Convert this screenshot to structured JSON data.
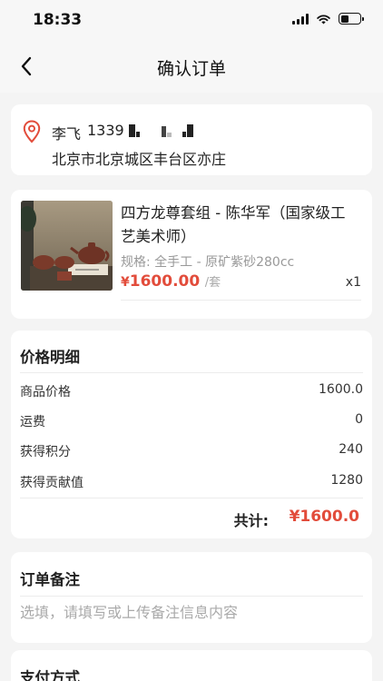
{
  "status_bar": {
    "time": "18:33"
  },
  "nav": {
    "title": "确认订单",
    "back_icon": "chevron-left-icon"
  },
  "address": {
    "name": "李飞",
    "phone_visible": "1339",
    "detail": "北京市北京城区丰台区亦庄"
  },
  "product": {
    "title": "四方龙尊套组 - 陈华军（国家级工艺美术师）",
    "spec": "规格: 全手工 - 原矿紫砂280cc",
    "currency": "¥",
    "price": "1600.00",
    "unit": "/套",
    "quantity": "x1"
  },
  "price_detail": {
    "title": "价格明细",
    "rows": [
      {
        "label": "商品价格",
        "value": "1600.0"
      },
      {
        "label": "运费",
        "value": "0"
      },
      {
        "label": "获得积分",
        "value": "240"
      },
      {
        "label": "获得贡献值",
        "value": "1280"
      }
    ],
    "total_label": "共计:",
    "total_value": "¥1600.0"
  },
  "remark": {
    "title": "订单备注",
    "placeholder": "选填，请填写或上传备注信息内容"
  },
  "payment": {
    "title": "支付方式"
  },
  "colors": {
    "accent": "#e24c3b",
    "background": "#f4f4f4"
  }
}
